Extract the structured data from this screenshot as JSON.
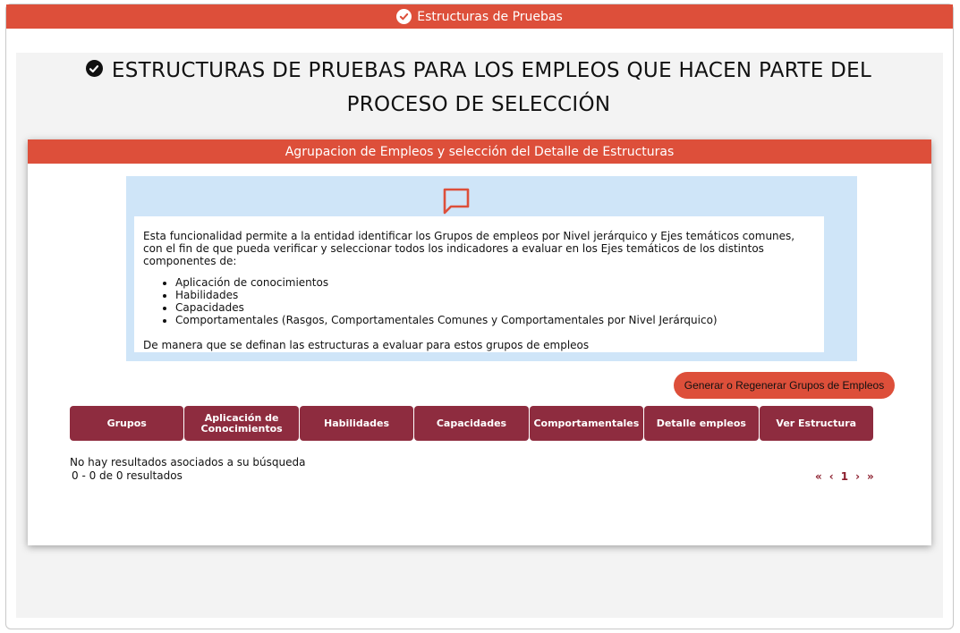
{
  "topbar": {
    "title": "Estructuras de Pruebas",
    "icon": "check-circle-icon"
  },
  "page": {
    "title_line1": "ESTRUCTURAS DE PRUEBAS PARA LOS EMPLEOS QUE HACEN PARTE DEL",
    "title_line2": "PROCESO DE SELECCIÓN"
  },
  "card": {
    "header": "Agrupacion de Empleos y selección del Detalle de Estructuras",
    "info": {
      "icon": "chat-icon",
      "paragraph": "Esta funcionalidad permite a la entidad identificar los Grupos de empleos por Nivel jerárquico y Ejes temáticos comunes, con el fin de que pueda verificar y seleccionar todos los indicadores a evaluar en los Ejes temáticos de los distintos componentes de:",
      "items": [
        "Aplicación de conocimientos",
        "Habilidades",
        "Capacidades",
        "Comportamentales (Rasgos, Comportamentales Comunes y Comportamentales por Nivel Jerárquico)"
      ],
      "closing": "De manera que se definan las estructuras a evaluar para estos grupos de empleos"
    },
    "regen_button": "Generar o Regenerar Grupos de Empleos",
    "tabs": [
      {
        "line1": "Grupos",
        "line2": ""
      },
      {
        "line1": "Aplicación de",
        "line2": "Conocimientos"
      },
      {
        "line1": "Habilidades",
        "line2": ""
      },
      {
        "line1": "Capacidades",
        "line2": ""
      },
      {
        "line1": "Comportamentales",
        "line2": ""
      },
      {
        "line1": "Detalle empleos",
        "line2": ""
      },
      {
        "line1": "Ver Estructura",
        "line2": ""
      }
    ],
    "no_results": "No hay resultados asociados a su búsqueda",
    "count": "0 - 0 de 0 resultados",
    "pager": {
      "first": "«",
      "prev": "‹",
      "current": "1",
      "next": "›",
      "last": "»"
    }
  },
  "colors": {
    "accent": "#dd4f3a",
    "tab": "#8e2c3f",
    "info_bg": "#cfe5f8",
    "pager": "#8b1d2c"
  }
}
